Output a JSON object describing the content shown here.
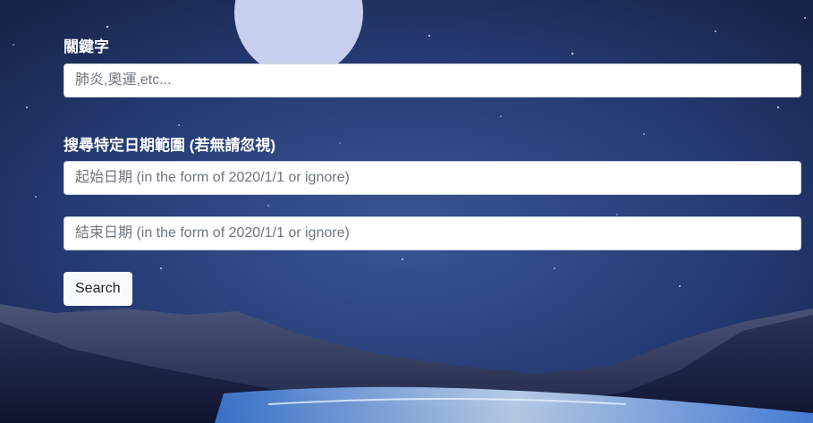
{
  "keyword": {
    "label": "關鍵字",
    "placeholder": "肺炎,奧運,etc..."
  },
  "date_range": {
    "label": "搜尋特定日期範圍 (若無請忽視)",
    "start_placeholder": "起始日期 (in the form of 2020/1/1 or ignore)",
    "end_placeholder": "結束日期 (in the form of 2020/1/1 or ignore)"
  },
  "search_button": {
    "label": "Search"
  },
  "colors": {
    "sky": "#22366a",
    "moon": "#c9d0ef",
    "mountains": "#1c2346",
    "glow": "#5aa0ff",
    "button_bg": "#f8f9fa"
  }
}
